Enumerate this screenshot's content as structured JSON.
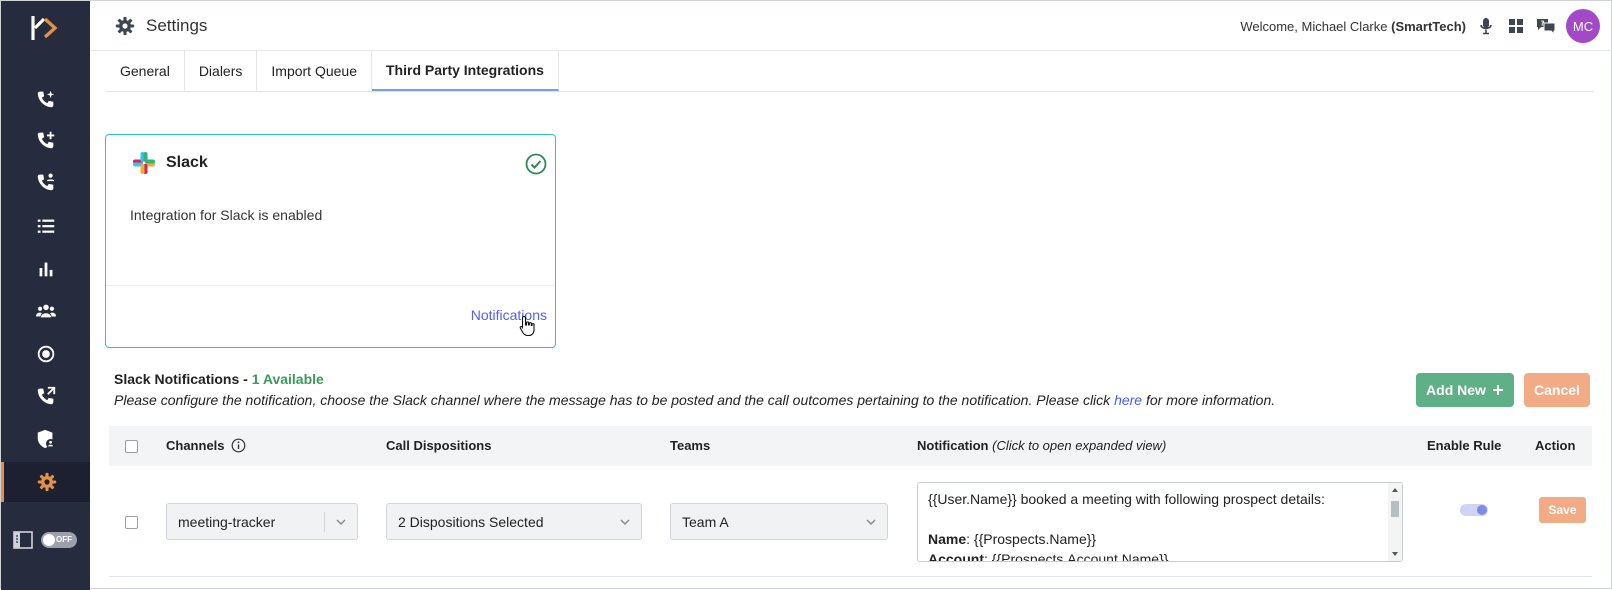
{
  "header": {
    "title": "Settings",
    "welcome_prefix": "Welcome, Michael Clarke",
    "company": "(SmartTech)",
    "avatar_initials": "MC"
  },
  "sidebar": {
    "items": [
      {
        "icon": "phone-sparkle-icon"
      },
      {
        "icon": "phone-add-icon"
      },
      {
        "icon": "phone-people-icon"
      },
      {
        "icon": "list-icon"
      },
      {
        "icon": "bar-chart-icon"
      },
      {
        "icon": "users-icon"
      },
      {
        "icon": "record-icon"
      },
      {
        "icon": "phone-transfer-icon"
      },
      {
        "icon": "shield-user-icon"
      },
      {
        "icon": "gear-icon",
        "active": true
      }
    ],
    "toggle_label": "OFF"
  },
  "tabs": [
    {
      "label": "General"
    },
    {
      "label": "Dialers"
    },
    {
      "label": "Import Queue"
    },
    {
      "label": "Third Party Integrations",
      "active": true
    }
  ],
  "integration_card": {
    "name": "Slack",
    "description": "Integration for Slack is enabled",
    "link_label": "Notifications"
  },
  "notifications": {
    "title": "Slack Notifications -",
    "available": "1 Available",
    "description_before": "Please configure the notification, choose the Slack channel where the message has to be posted and the call outcomes pertaining to the notification. Please click",
    "link": "here",
    "description_after": "for more information.",
    "add_label": "Add New",
    "cancel_label": "Cancel"
  },
  "table": {
    "headers": {
      "channels": "Channels",
      "dispositions": "Call Dispositions",
      "teams": "Teams",
      "notification": "Notification",
      "notification_hint": "(Click to open expanded view)",
      "enable_rule": "Enable Rule",
      "action": "Action"
    },
    "rows": [
      {
        "channel": "meeting-tracker",
        "dispositions": "2 Dispositions Selected",
        "team": "Team A",
        "notification_line1": "{{User.Name}} booked a meeting with following prospect details:",
        "name_label": "Name",
        "name_value": ": {{Prospects.Name}}",
        "account_label": "Account",
        "account_value": ": {{Prospects.Account.Name}}",
        "enabled": true,
        "save_label": "Save"
      }
    ]
  },
  "colors": {
    "sidebar_bg": "#262b3d",
    "accent_orange": "#e0914a",
    "add_green": "#5fb086",
    "cancel_orange": "#f3ab86",
    "link_blue": "#5660e8",
    "card_border": "#2ec0d3",
    "avatar_purple": "#a349c8"
  }
}
